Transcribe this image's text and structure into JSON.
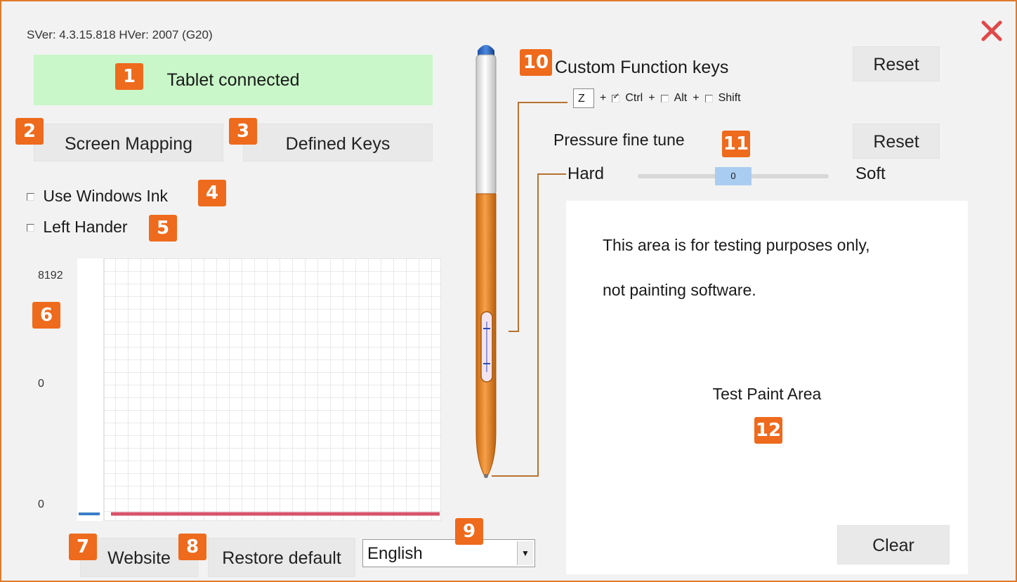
{
  "header": {
    "version": "SVer: 4.3.15.818  HVer: 2007  (G20)"
  },
  "status": {
    "text": "Tablet connected",
    "badge": "1"
  },
  "buttons": {
    "screen_mapping": "Screen Mapping",
    "defined_keys": "Defined Keys",
    "website": "Website",
    "restore_default": "Restore default",
    "reset_function": "Reset",
    "reset_pressure": "Reset",
    "clear": "Clear"
  },
  "badges": [
    "1",
    "2",
    "3",
    "4",
    "5",
    "6",
    "7",
    "8",
    "9",
    "10",
    "11",
    "12"
  ],
  "options": {
    "use_windows_ink": {
      "label": "Use Windows Ink",
      "checked": false
    },
    "left_hander": {
      "label": "Left Hander",
      "checked": false
    }
  },
  "pressure_chart": {
    "y_labels": [
      "8192",
      "0",
      "0"
    ]
  },
  "language": {
    "selected": "English"
  },
  "custom_function": {
    "title": "Custom Function keys",
    "key_value": "Z",
    "plus": "+",
    "ctrl": {
      "label": "Ctrl",
      "checked": true
    },
    "alt": {
      "label": "Alt",
      "checked": false
    },
    "shift": {
      "label": "Shift",
      "checked": false
    }
  },
  "pressure_tune": {
    "title": "Pressure fine tune",
    "hard_label": "Hard",
    "soft_label": "Soft",
    "value": "0"
  },
  "test_area": {
    "line1": "This area is for testing purposes only,",
    "line2": "not painting software.",
    "center_label": "Test Paint Area"
  },
  "colors": {
    "accent": "#ee6a1c",
    "status_bg": "#c9f7c9",
    "pressure_line": "#d8536a",
    "slider_thumb": "#a9cdf0"
  }
}
